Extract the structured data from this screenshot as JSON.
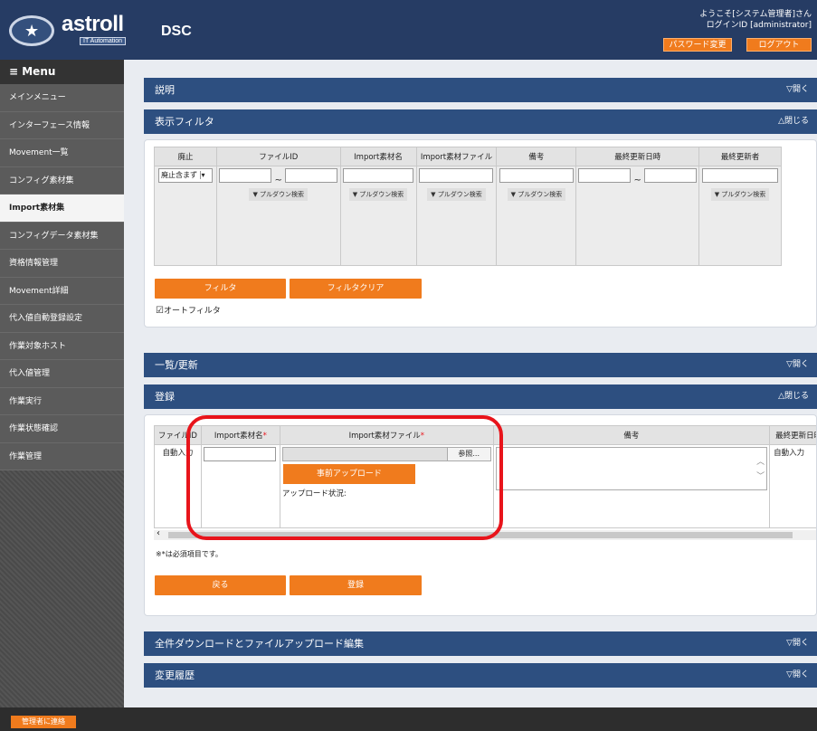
{
  "header": {
    "logo_brand": "astroll",
    "logo_tagline": "IT Automation",
    "app_title": "DSC",
    "welcome_line1": "ようこそ[システム管理者]さん",
    "welcome_line2": "ログインID [administrator]",
    "password_button": "パスワード変更",
    "logout_button": "ログアウト"
  },
  "sidebar": {
    "menu_title": "≡ Menu",
    "items": [
      {
        "label": "メインメニュー",
        "active": false
      },
      {
        "label": "インターフェース情報",
        "active": false
      },
      {
        "label": "Movement一覧",
        "active": false
      },
      {
        "label": "コンフィグ素材集",
        "active": false
      },
      {
        "label": "Import素材集",
        "active": true
      },
      {
        "label": "コンフィグデータ素材集",
        "active": false
      },
      {
        "label": "資格情報管理",
        "active": false
      },
      {
        "label": "Movement詳細",
        "active": false
      },
      {
        "label": "代入値自動登録設定",
        "active": false
      },
      {
        "label": "作業対象ホスト",
        "active": false
      },
      {
        "label": "代入値管理",
        "active": false
      },
      {
        "label": "作業実行",
        "active": false
      },
      {
        "label": "作業状態確認",
        "active": false
      },
      {
        "label": "作業管理",
        "active": false
      }
    ]
  },
  "sections": {
    "description": {
      "title": "説明",
      "toggle": "▽開く"
    },
    "filter": {
      "title": "表示フィルタ",
      "toggle": "△閉じる"
    },
    "list": {
      "title": "一覧/更新",
      "toggle": "▽開く"
    },
    "register": {
      "title": "登録",
      "toggle": "△閉じる"
    },
    "download": {
      "title": "全件ダウンロードとファイルアップロード編集",
      "toggle": "▽開く"
    },
    "history": {
      "title": "変更履歴",
      "toggle": "▽開く"
    }
  },
  "filter": {
    "columns": [
      "廃止",
      "ファイルID",
      "Import素材名",
      "Import素材ファイル",
      "備考",
      "最終更新日時",
      "最終更新者"
    ],
    "discard_select": "廃止含まず",
    "range_sep": "~",
    "pulldown": "▼ プルダウン検索",
    "filter_button": "フィルタ",
    "clear_button": "フィルタクリア",
    "auto_filter": "オートフィルタ",
    "auto_filter_checked": true
  },
  "register": {
    "columns": [
      "ファイルID",
      "Import素材名",
      "Import素材ファイル",
      "備考",
      "最終更新日時"
    ],
    "required_mark": "*",
    "auto_input": "自動入力",
    "browse_button": "参照...",
    "pre_upload_button": "事前アップロード",
    "upload_status": "アップロード状況:",
    "required_note": "※*は必須項目です。",
    "back_button": "戻る",
    "register_button": "登録"
  },
  "footer": {
    "contact_button": "管理者に連絡"
  },
  "highlight_color": "#e8141b",
  "accent_color": "#f07b1d",
  "bar_color": "#2d4f80"
}
